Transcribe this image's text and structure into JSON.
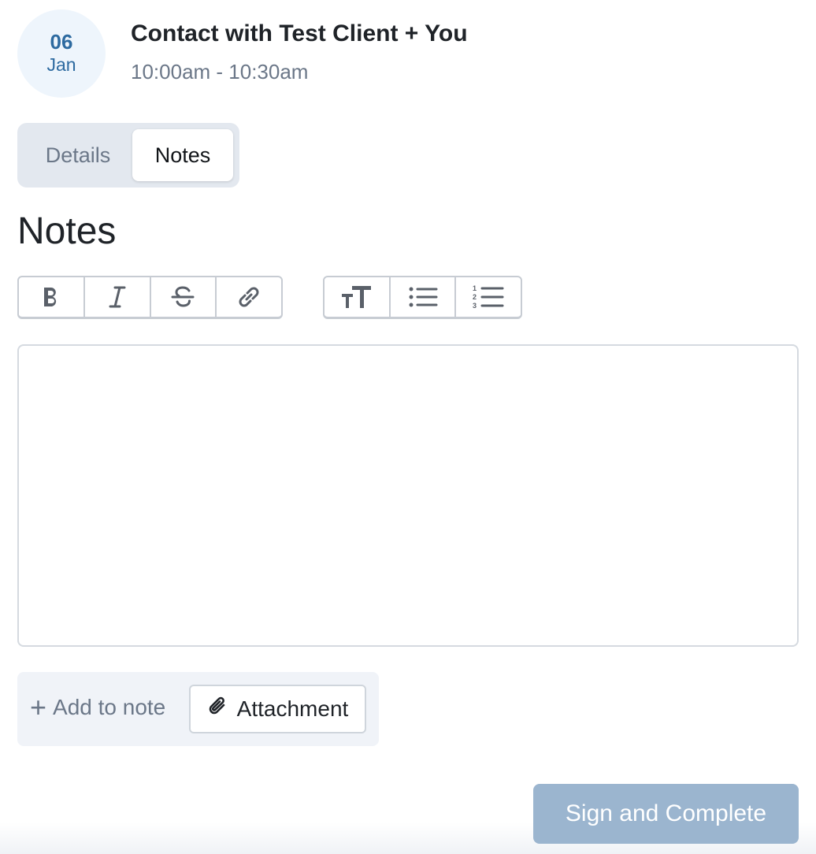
{
  "appointment": {
    "day": "06",
    "month": "Jan",
    "title": "Contact with Test Client + You",
    "time": "10:00am - 10:30am"
  },
  "tabs": [
    {
      "label": "Details",
      "active": false
    },
    {
      "label": "Notes",
      "active": true
    }
  ],
  "notes": {
    "heading": "Notes",
    "toolbar": {
      "format_group": [
        "bold-icon",
        "italic-icon",
        "strikethrough-icon",
        "link-icon"
      ],
      "block_group": [
        "text-size-icon",
        "bullet-list-icon",
        "numbered-list-icon"
      ]
    },
    "editor_value": ""
  },
  "add_bar": {
    "add_to_note_label": "Add to note",
    "attachment_label": "Attachment"
  },
  "footer": {
    "sign_complete_label": "Sign and Complete"
  },
  "colors": {
    "accent": "#2d6aa0",
    "button_disabled": "#9bb5cf",
    "muted_text": "#6b7788"
  }
}
